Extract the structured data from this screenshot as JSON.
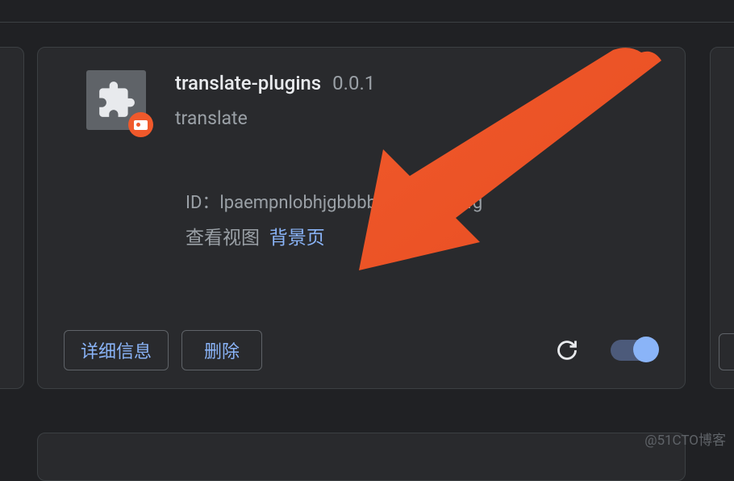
{
  "extension": {
    "name": "translate-plugins",
    "version": "0.0.1",
    "description": "translate",
    "id_label": "ID：",
    "id_value": "lpaempnlobhjgbbbbbgjpbijeakefg",
    "view_label": "查看视图",
    "view_link": "背景页"
  },
  "buttons": {
    "details": "详细信息",
    "remove": "删除"
  },
  "watermark": "@51CTO博客"
}
